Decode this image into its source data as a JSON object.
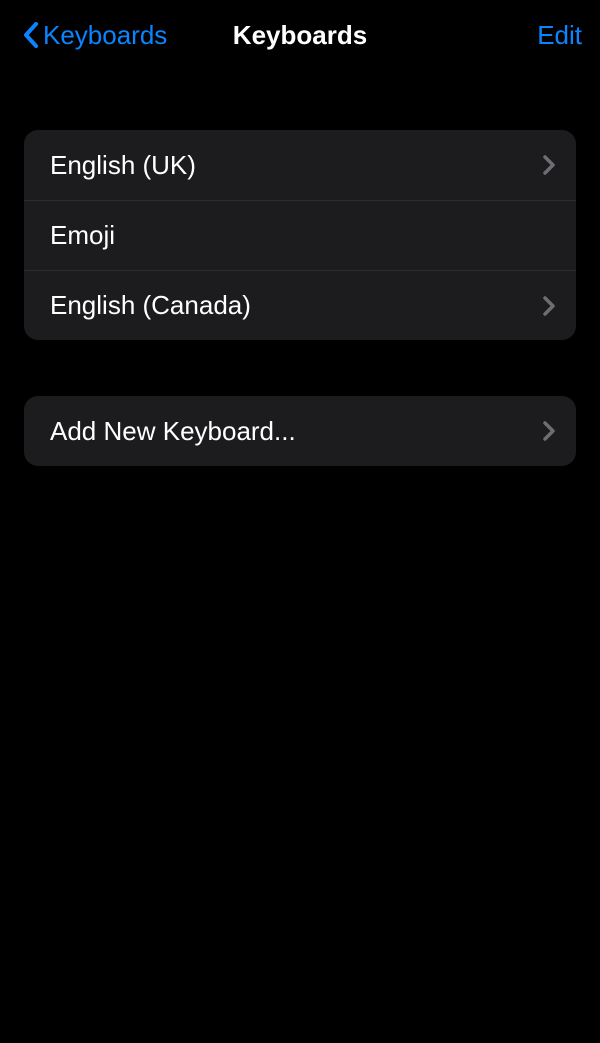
{
  "nav": {
    "back_label": "Keyboards",
    "title": "Keyboards",
    "edit_label": "Edit"
  },
  "keyboards": {
    "items": [
      {
        "label": "English (UK)",
        "has_detail": true
      },
      {
        "label": "Emoji",
        "has_detail": false
      },
      {
        "label": "English (Canada)",
        "has_detail": true
      }
    ]
  },
  "add": {
    "label": "Add New Keyboard..."
  },
  "icons": {
    "chevron_right": "chevron-right-icon",
    "chevron_left": "chevron-left-icon"
  },
  "colors": {
    "accent": "#0a84ff"
  }
}
